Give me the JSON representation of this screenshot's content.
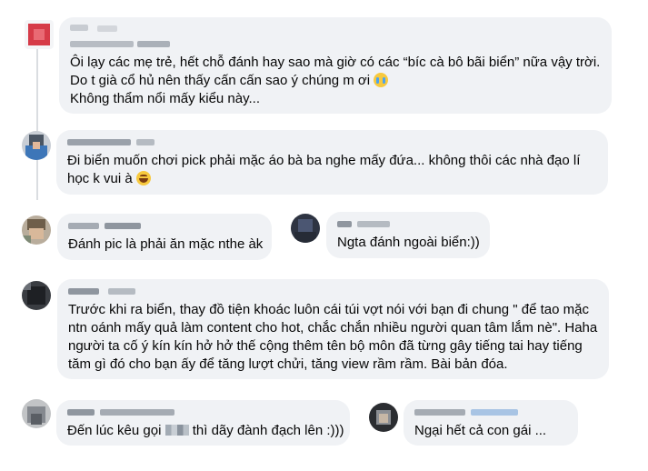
{
  "comments": [
    {
      "lines": [
        "Ôi lạy các mẹ trẻ, hết chỗ đánh hay sao mà giờ có các “bíc cà bô bãi biển” nữa vậy trời.",
        "Do t già cổ hủ nên thấy cấn cấn sao ý chúng m ơi",
        "Không thẩm nổi mấy kiểu này..."
      ]
    },
    {
      "lines": [
        "Đi biển muốn chơi pick phải mặc áo bà ba nghe mấy đứa... không thôi các nhà đạo lí",
        "học k vui à"
      ]
    },
    {
      "lines": [
        "Đánh pic là phải ăn mặc nthe àk"
      ]
    },
    {
      "lines": [
        "Ngta đánh ngoài biển:))"
      ]
    },
    {
      "lines": [
        "Trước khi ra biển, thay đồ tiện khoác luôn cái túi vợt nói với bạn đi chung \" để tao mặc",
        "ntn oánh mấy quả làm content cho hot, chắc chắn nhiều người quan tâm lắm nè\". Haha",
        "người ta cố ý kín kín hở hở thế cộng thêm tên bộ môn đã từng gây tiếng tai hay tiếng",
        "tăm gì đó cho bạn ấy để tăng lượt chửi, tăng view rầm rầm. Bài bản đóa."
      ]
    },
    {
      "line_before_blur": "Đến lúc kêu gọi ",
      "line_after_blur": " thì dãy đành đạch lên :)))"
    },
    {
      "lines": [
        "Ngại hết cả con gái ..."
      ]
    }
  ],
  "emojis": {
    "cry": "loudly-crying-face-emoji",
    "smile": "grinning-squinting-face-emoji"
  },
  "colors": {
    "bubble": "#f0f2f5",
    "thread_line": "#dadde1",
    "text": "#050505"
  }
}
